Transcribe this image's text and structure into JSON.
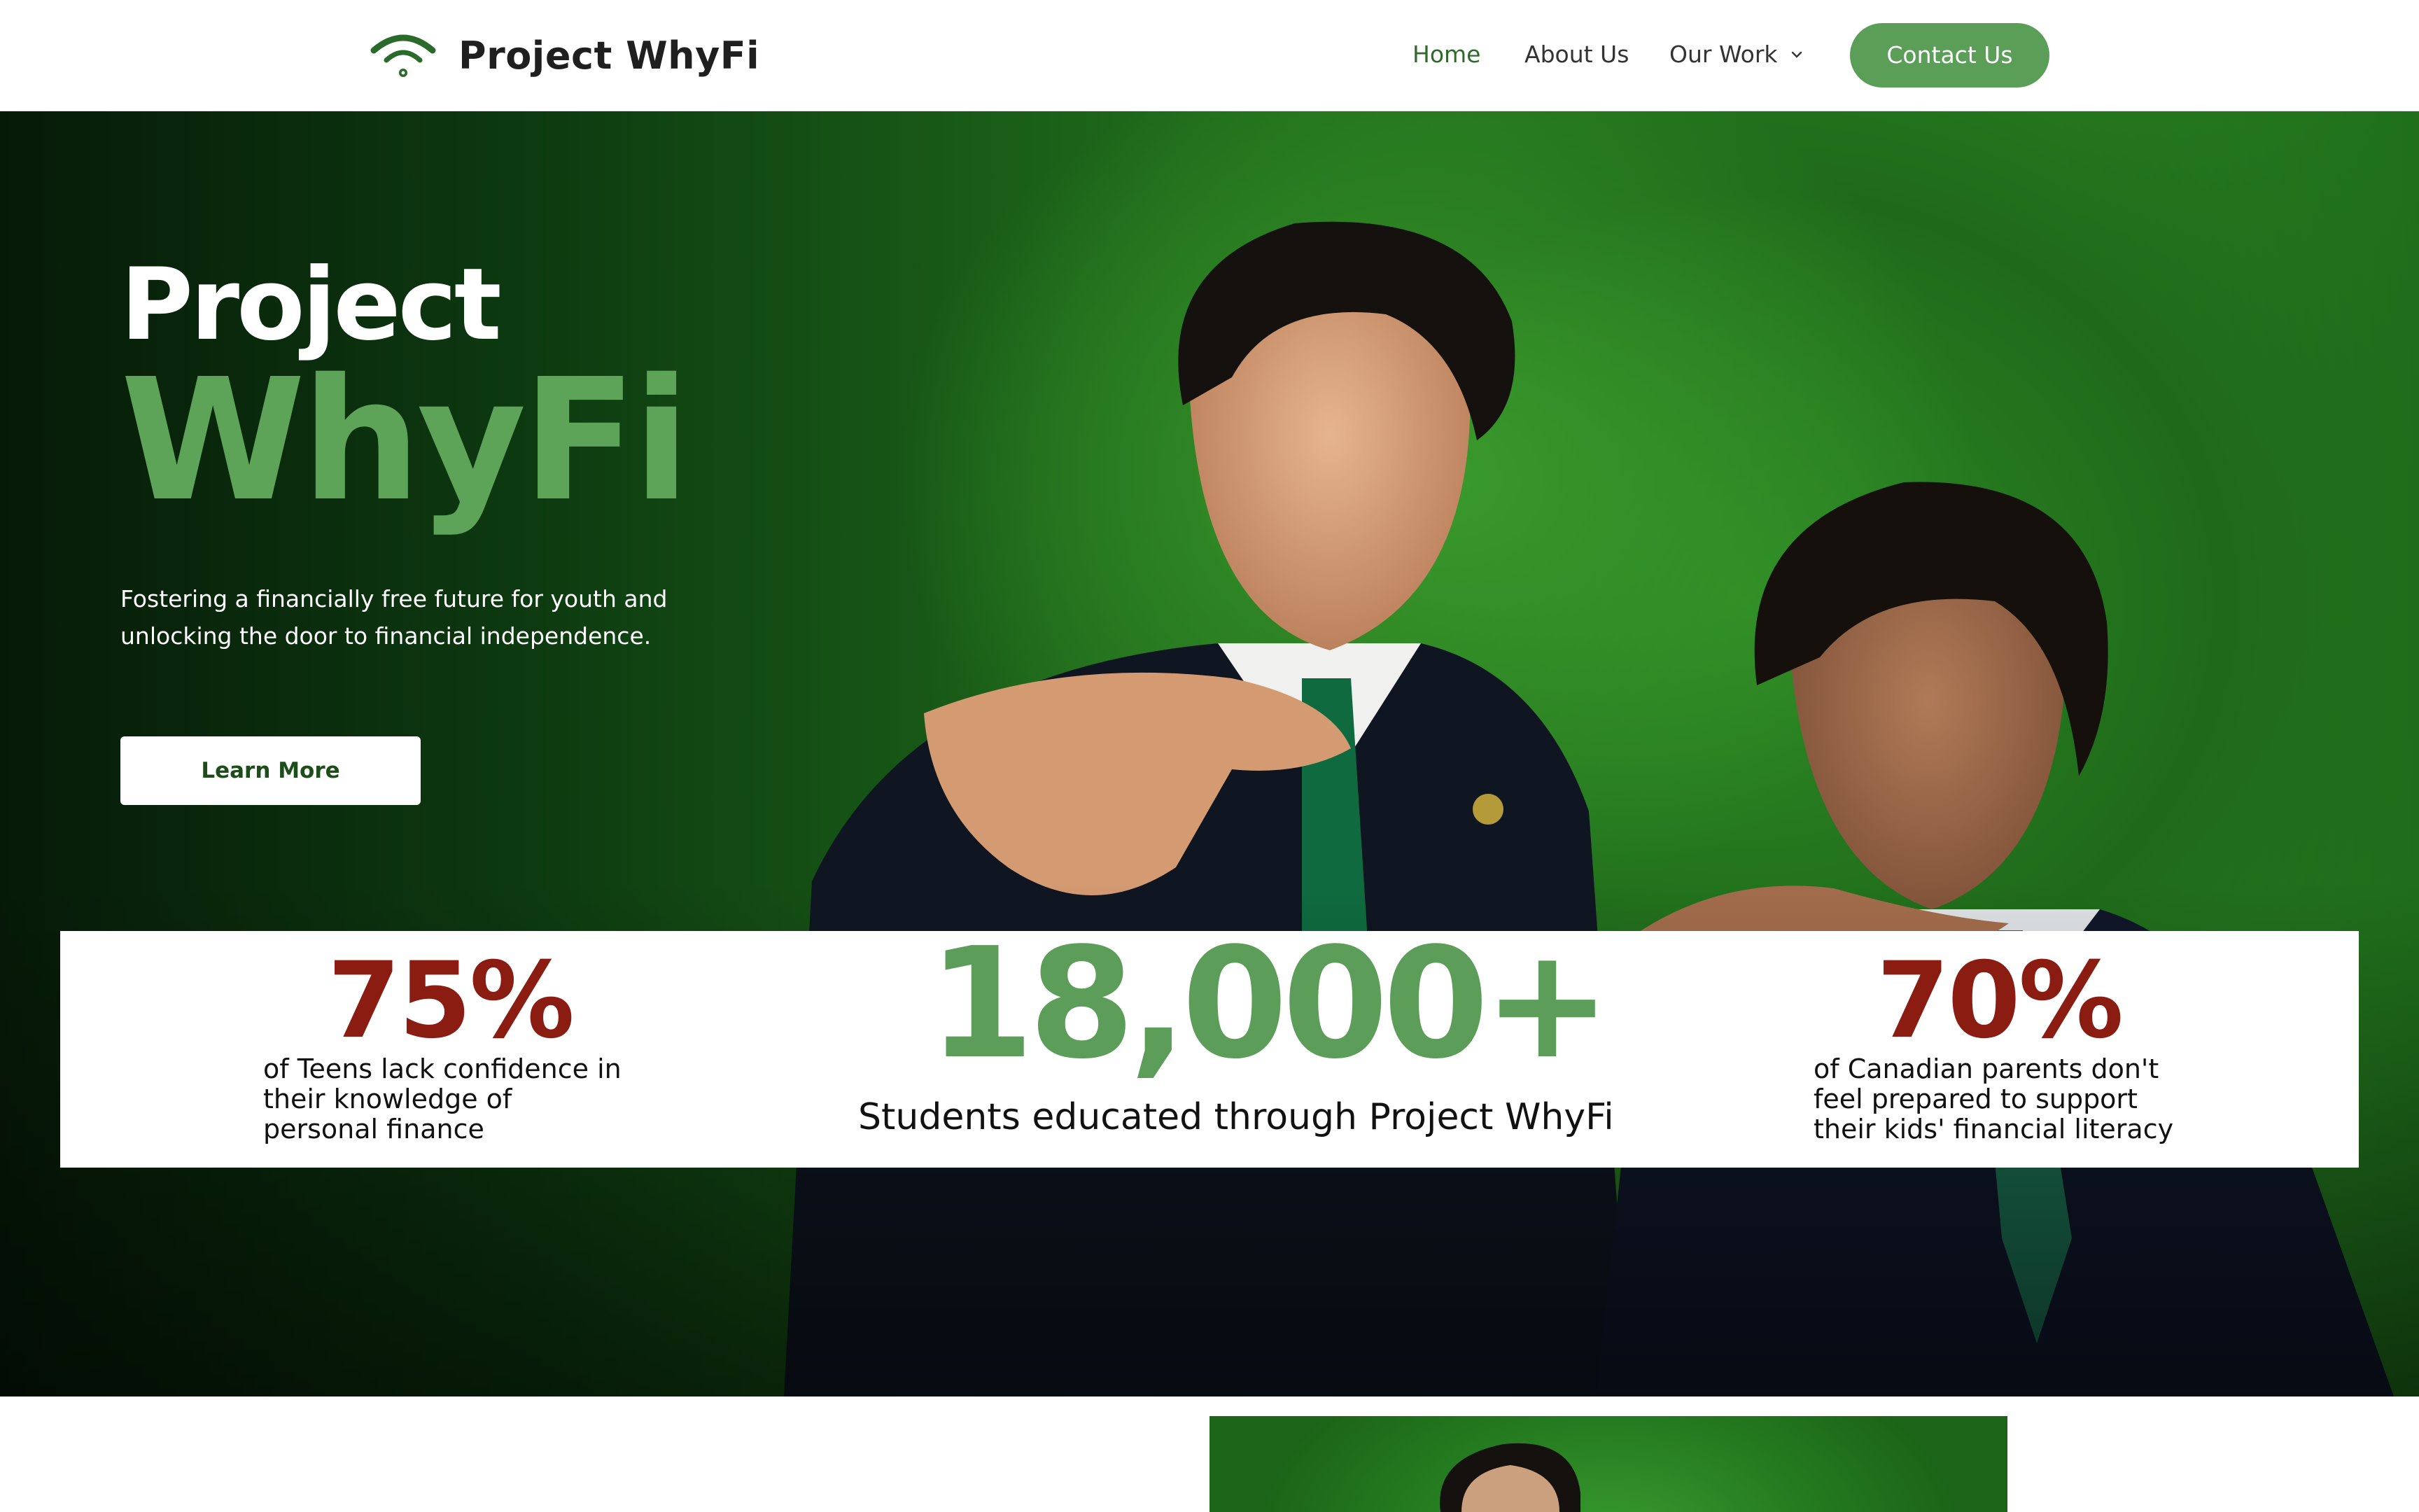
{
  "header": {
    "brand": "Project WhyFi",
    "logo_icon": "wifi-logo-icon",
    "nav": {
      "home": "Home",
      "about": "About Us",
      "work": "Our Work"
    },
    "contact_label": "Contact Us"
  },
  "hero": {
    "title_line1": "Project",
    "title_line2": "WhyFi",
    "subtitle": "Fostering a financially free future for youth and unlocking the door to financial independence.",
    "cta_label": "Learn More"
  },
  "stats": [
    {
      "value": "75%",
      "desc": "of Teens lack confidence in their knowledge of personal finance"
    },
    {
      "value": "18,000+",
      "desc": "Students educated through Project WhyFi"
    },
    {
      "value": "70%",
      "desc": "of Canadian parents don't feel prepared to support their kids' financial literacy"
    }
  ],
  "colors": {
    "brand_green": "#5a9e57",
    "stat_red": "#8a1c12",
    "hero_green": "#2a8321"
  }
}
